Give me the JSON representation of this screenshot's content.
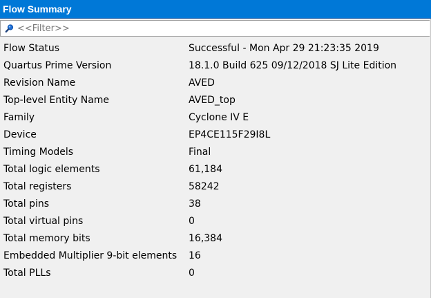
{
  "window": {
    "title": "Flow Summary"
  },
  "filter": {
    "placeholder": "<<Filter>>",
    "value": ""
  },
  "rows": [
    {
      "label": "Flow Status",
      "value": "Successful - Mon Apr 29 21:23:35 2019"
    },
    {
      "label": "Quartus Prime Version",
      "value": "18.1.0 Build 625 09/12/2018 SJ Lite Edition"
    },
    {
      "label": "Revision Name",
      "value": "AVED"
    },
    {
      "label": "Top-level Entity Name",
      "value": "AVED_top"
    },
    {
      "label": "Family",
      "value": "Cyclone IV E"
    },
    {
      "label": "Device",
      "value": "EP4CE115F29I8L"
    },
    {
      "label": "Timing Models",
      "value": "Final"
    },
    {
      "label": "Total logic elements",
      "value": "61,184"
    },
    {
      "label": "Total registers",
      "value": "58242"
    },
    {
      "label": "Total pins",
      "value": "38"
    },
    {
      "label": "Total virtual pins",
      "value": "0"
    },
    {
      "label": "Total memory bits",
      "value": "16,384"
    },
    {
      "label": "Embedded Multiplier 9-bit elements",
      "value": "16"
    },
    {
      "label": "Total PLLs",
      "value": "0"
    }
  ],
  "icons": {
    "filter": "search-icon"
  },
  "colors": {
    "titlebar": "#0078d7",
    "title_text": "#ffffff",
    "background": "#f0f0f0",
    "search_icon": "#1e6fd6"
  }
}
